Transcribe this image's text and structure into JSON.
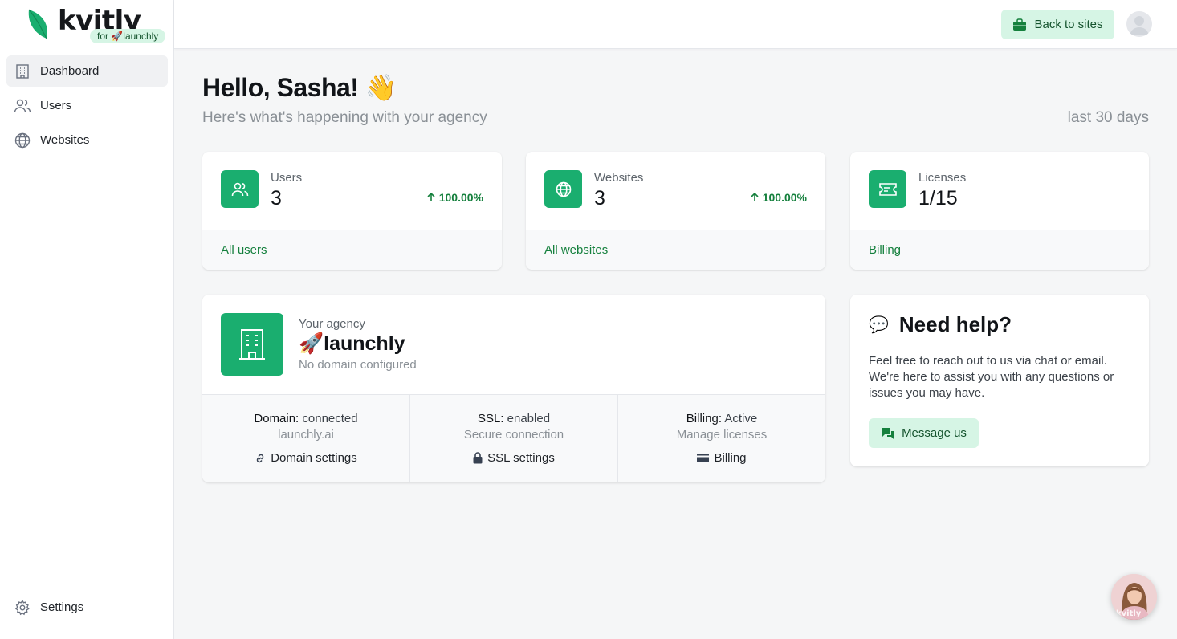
{
  "sidebar": {
    "logo_text": "kvitly",
    "logo_badge": "for 🚀launchly",
    "items": [
      {
        "label": "Dashboard",
        "icon": "building-icon",
        "active": true
      },
      {
        "label": "Users",
        "icon": "users-icon"
      },
      {
        "label": "Websites",
        "icon": "globe-icon"
      }
    ],
    "settings_label": "Settings"
  },
  "topbar": {
    "back_label": "Back to sites"
  },
  "header": {
    "greeting": "Hello, Sasha! 👋",
    "subtitle": "Here's what's happening with your agency",
    "period": "last 30 days"
  },
  "stats": [
    {
      "label": "Users",
      "value": "3",
      "change": "100.00%",
      "link": "All users",
      "icon": "users-icon"
    },
    {
      "label": "Websites",
      "value": "3",
      "change": "100.00%",
      "link": "All websites",
      "icon": "globe-icon"
    },
    {
      "label": "Licenses",
      "value": "1/15",
      "change": "",
      "link": "Billing",
      "icon": "ticket-icon"
    }
  ],
  "agency": {
    "label": "Your agency",
    "name": "🚀launchly",
    "domain_note": "No domain configured",
    "columns": [
      {
        "key": "Domain:",
        "status": "connected",
        "sub": "launchly.ai",
        "link": "Domain settings",
        "icon": "link-icon"
      },
      {
        "key": "SSL:",
        "status": "enabled",
        "sub": "Secure connection",
        "link": "SSL settings",
        "icon": "lock-icon"
      },
      {
        "key": "Billing:",
        "status": "Active",
        "sub": "Manage licenses",
        "link": "Billing",
        "icon": "credit-card-icon"
      }
    ]
  },
  "help": {
    "icon": "💬",
    "title": "Need help?",
    "text": "Feel free to reach out to us via chat or email. We're here to assist you with any questions or issues you may have.",
    "button": "Message us"
  },
  "chat": {
    "tag": "kvitly"
  },
  "colors": {
    "accent": "#1aae6f",
    "accent_soft": "#d6f5e5",
    "link": "#15803d"
  }
}
